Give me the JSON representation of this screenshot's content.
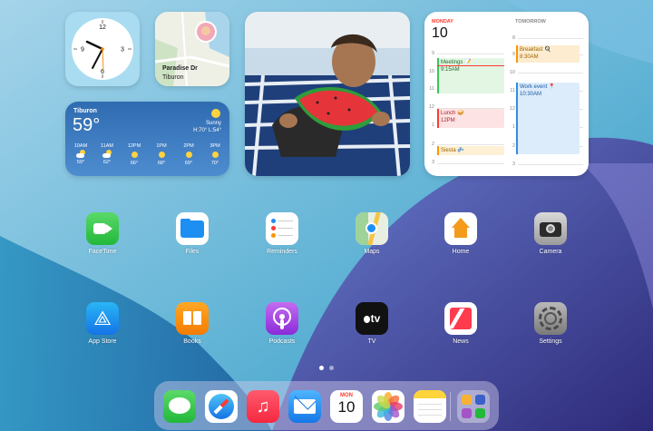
{
  "clock": {
    "hour_label_12": "12",
    "hour_label_3": "3",
    "hour_label_6": "6",
    "hour_label_9": "9"
  },
  "map": {
    "place": "Paradise Dr",
    "city": "Tiburon"
  },
  "weather": {
    "city": "Tiburon",
    "temp": "59°",
    "condition": "Sunny",
    "hilo": "H:70° L:54°",
    "hours": [
      {
        "time": "10AM",
        "icon": "partly-cloudy-icon",
        "temp": "59°"
      },
      {
        "time": "11AM",
        "icon": "partly-cloudy-icon",
        "temp": "62°"
      },
      {
        "time": "12PM",
        "icon": "sun-icon",
        "temp": "66°"
      },
      {
        "time": "1PM",
        "icon": "sun-icon",
        "temp": "68°"
      },
      {
        "time": "2PM",
        "icon": "sun-icon",
        "temp": "69°"
      },
      {
        "time": "3PM",
        "icon": "sun-icon",
        "temp": "70°"
      }
    ]
  },
  "calendar": {
    "today_label": "MONDAY",
    "today_date": "10",
    "tomorrow_label": "TOMORROW",
    "hours_left": [
      "9",
      "10",
      "11",
      "12",
      "1",
      "2",
      "3"
    ],
    "hours_right": [
      "8",
      "9",
      "10",
      "11",
      "12",
      "1",
      "2",
      "3"
    ],
    "events": [
      {
        "title": "Meetings 📝",
        "time": "9:15AM"
      },
      {
        "title": "Lunch 🥪",
        "time": "12PM"
      },
      {
        "title": "Siesta 💤",
        "time": ""
      },
      {
        "title": "Breakfast 🍳",
        "time": "8:30AM"
      },
      {
        "title": "Work event 📍",
        "time": "10:30AM"
      }
    ],
    "colors": {
      "green": "#34c759",
      "red": "#ff3b30",
      "orange": "#ff9500",
      "blue": "#2f8ee5"
    }
  },
  "apps": {
    "row1": [
      {
        "label": "FaceTime",
        "icon": "facetime-icon"
      },
      {
        "label": "Files",
        "icon": "files-icon"
      },
      {
        "label": "Reminders",
        "icon": "reminders-icon"
      },
      {
        "label": "Maps",
        "icon": "maps-icon"
      },
      {
        "label": "Home",
        "icon": "home-icon"
      },
      {
        "label": "Camera",
        "icon": "camera-icon"
      }
    ],
    "row2": [
      {
        "label": "App Store",
        "icon": "app-store-icon"
      },
      {
        "label": "Books",
        "icon": "books-icon"
      },
      {
        "label": "Podcasts",
        "icon": "podcasts-icon"
      },
      {
        "label": "TV",
        "icon": "tv-icon"
      },
      {
        "label": "News",
        "icon": "news-icon"
      },
      {
        "label": "Settings",
        "icon": "settings-icon"
      }
    ]
  },
  "tv_icon_text": "tv",
  "dock": {
    "apps": [
      "Messages",
      "Safari",
      "Music",
      "Mail",
      "Calendar",
      "Photos",
      "Notes",
      "App Library"
    ],
    "calendar_day": "MON",
    "calendar_date": "10"
  },
  "page_indicator": {
    "current": 1,
    "total": 2
  }
}
